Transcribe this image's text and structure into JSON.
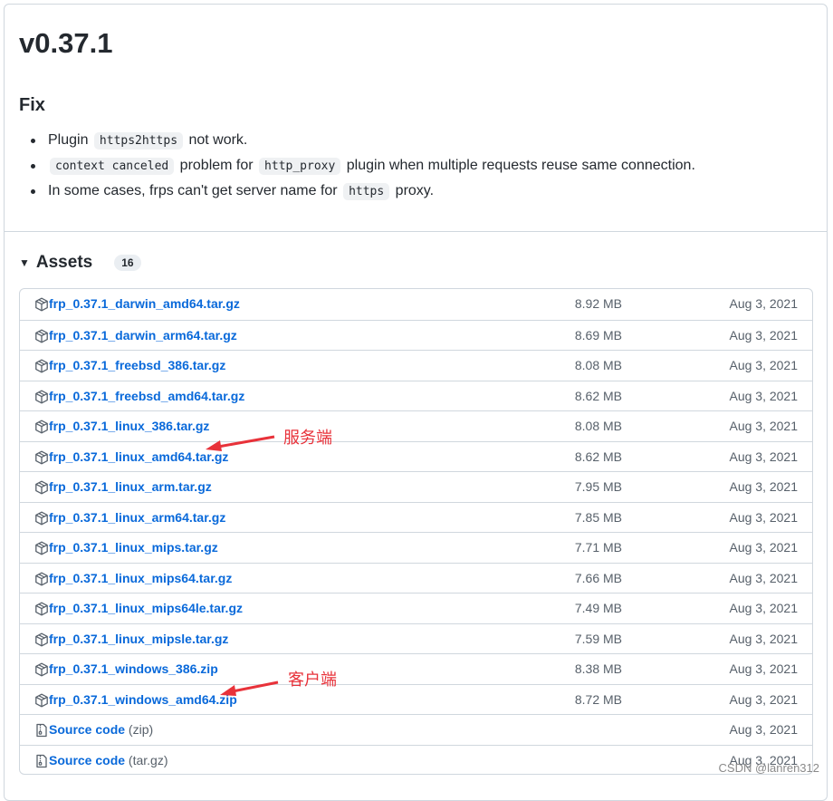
{
  "release": {
    "title": "v0.37.1",
    "section": "Fix",
    "notes": [
      {
        "before": "Plugin ",
        "code": "https2https",
        "after": " not work.",
        "code2": "",
        "after2": ""
      },
      {
        "before": "",
        "code": "context canceled",
        "after": " problem for ",
        "code2": "http_proxy",
        "after2": " plugin when multiple requests reuse same connection."
      },
      {
        "before": "In some cases, frps can't get server name for ",
        "code": "https",
        "after": " proxy.",
        "code2": "",
        "after2": ""
      }
    ]
  },
  "assets": {
    "title": "Assets",
    "count": "16",
    "rows": [
      {
        "name": "frp_0.37.1_darwin_amd64.tar.gz",
        "suffix": "",
        "size": "8.92 MB",
        "date": "Aug 3, 2021",
        "icon": "package-icon"
      },
      {
        "name": "frp_0.37.1_darwin_arm64.tar.gz",
        "suffix": "",
        "size": "8.69 MB",
        "date": "Aug 3, 2021",
        "icon": "package-icon"
      },
      {
        "name": "frp_0.37.1_freebsd_386.tar.gz",
        "suffix": "",
        "size": "8.08 MB",
        "date": "Aug 3, 2021",
        "icon": "package-icon"
      },
      {
        "name": "frp_0.37.1_freebsd_amd64.tar.gz",
        "suffix": "",
        "size": "8.62 MB",
        "date": "Aug 3, 2021",
        "icon": "package-icon"
      },
      {
        "name": "frp_0.37.1_linux_386.tar.gz",
        "suffix": "",
        "size": "8.08 MB",
        "date": "Aug 3, 2021",
        "icon": "package-icon"
      },
      {
        "name": "frp_0.37.1_linux_amd64.tar.gz",
        "suffix": "",
        "size": "8.62 MB",
        "date": "Aug 3, 2021",
        "icon": "package-icon"
      },
      {
        "name": "frp_0.37.1_linux_arm.tar.gz",
        "suffix": "",
        "size": "7.95 MB",
        "date": "Aug 3, 2021",
        "icon": "package-icon"
      },
      {
        "name": "frp_0.37.1_linux_arm64.tar.gz",
        "suffix": "",
        "size": "7.85 MB",
        "date": "Aug 3, 2021",
        "icon": "package-icon"
      },
      {
        "name": "frp_0.37.1_linux_mips.tar.gz",
        "suffix": "",
        "size": "7.71 MB",
        "date": "Aug 3, 2021",
        "icon": "package-icon"
      },
      {
        "name": "frp_0.37.1_linux_mips64.tar.gz",
        "suffix": "",
        "size": "7.66 MB",
        "date": "Aug 3, 2021",
        "icon": "package-icon"
      },
      {
        "name": "frp_0.37.1_linux_mips64le.tar.gz",
        "suffix": "",
        "size": "7.49 MB",
        "date": "Aug 3, 2021",
        "icon": "package-icon"
      },
      {
        "name": "frp_0.37.1_linux_mipsle.tar.gz",
        "suffix": "",
        "size": "7.59 MB",
        "date": "Aug 3, 2021",
        "icon": "package-icon"
      },
      {
        "name": "frp_0.37.1_windows_386.zip",
        "suffix": "",
        "size": "8.38 MB",
        "date": "Aug 3, 2021",
        "icon": "package-icon"
      },
      {
        "name": "frp_0.37.1_windows_amd64.zip",
        "suffix": "",
        "size": "8.72 MB",
        "date": "Aug 3, 2021",
        "icon": "package-icon"
      },
      {
        "name": "Source code",
        "suffix": " (zip)",
        "size": "",
        "date": "Aug 3, 2021",
        "icon": "file-zip-icon"
      },
      {
        "name": "Source code",
        "suffix": " (tar.gz)",
        "size": "",
        "date": "Aug 3, 2021",
        "icon": "file-zip-icon"
      }
    ]
  },
  "annotations": {
    "server": "服务端",
    "client": "客户端",
    "color": "#e8323a"
  },
  "watermark": "CSDN @lanren312",
  "colors": {
    "link": "#0969da",
    "muted": "#57606a",
    "border": "#d0d7de"
  }
}
